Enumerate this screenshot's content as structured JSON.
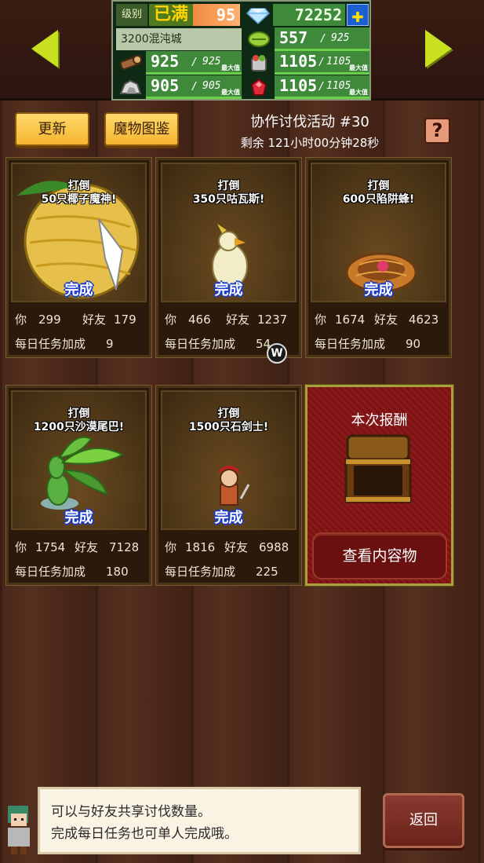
{
  "status": {
    "level_label": "级别",
    "level_max": "已满",
    "level_value": "95",
    "gems": "72252",
    "plus": "✚",
    "city": "3200混沌城",
    "wood": {
      "current": "925",
      "max": "925",
      "tag": "最大值"
    },
    "stone": {
      "current": "905",
      "max": "905",
      "tag": "最大值"
    },
    "crop": {
      "current": "557",
      "max": "925"
    },
    "food": {
      "current": "1105",
      "max": "1105",
      "tag": "最大值"
    },
    "gemstone": {
      "current": "1105",
      "max": "1105",
      "tag": "最大值"
    }
  },
  "header": {
    "refresh_label": "更新",
    "bestiary_label": "魔物图鉴",
    "event_title": "协作讨伐活动 #30",
    "event_timer": "剩余 121小时00分钟28秒",
    "help_label": "?"
  },
  "labels": {
    "you": "你",
    "friends": "好友",
    "daily_bonus": "每日任务加成",
    "defeat": "打倒",
    "complete": "完成"
  },
  "quests": [
    {
      "target": "50只椰子魔神!",
      "you": "299",
      "friends": "179",
      "bonus": "9"
    },
    {
      "target": "350只咕瓦斯!",
      "you": "466",
      "friends": "1237",
      "bonus": "54"
    },
    {
      "target": "600只陷阱蜂!",
      "you": "1674",
      "friends": "4623",
      "bonus": "90"
    },
    {
      "target": "1200只沙漠尾巴!",
      "you": "1754",
      "friends": "7128",
      "bonus": "180"
    },
    {
      "target": "1500只石剑士!",
      "you": "1816",
      "friends": "6988",
      "bonus": "225"
    }
  ],
  "reward": {
    "title": "本次报酬",
    "view_label": "查看内容物"
  },
  "footer": {
    "line1": "可以与好友共享讨伐数量。",
    "line2": "完成每日任务也可单人完成哦。",
    "back_label": "返回"
  },
  "overlay": {
    "badge": "W"
  }
}
